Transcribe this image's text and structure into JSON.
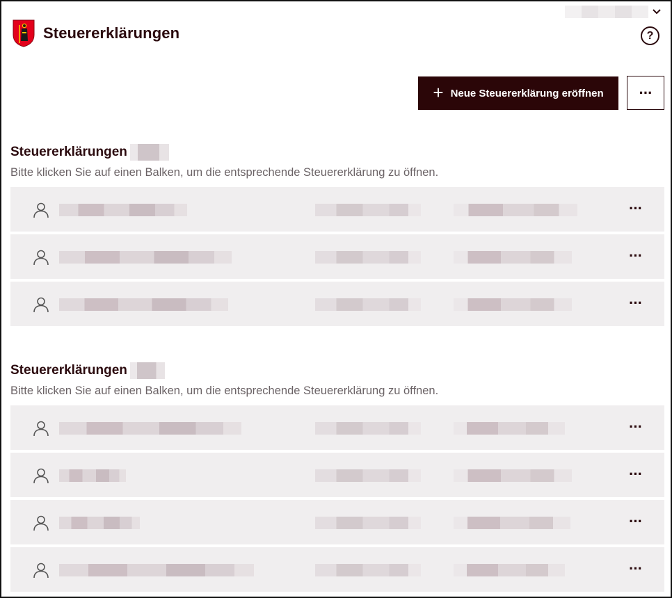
{
  "header": {
    "app_title": "Steuererklärungen",
    "help_label": "?"
  },
  "user_menu": {
    "icon": "chevron-down-icon"
  },
  "toolbar": {
    "new_label": "Neue Steuererklärung eröffnen",
    "more_label": "···"
  },
  "sections": [
    {
      "title": "Steuererklärungen",
      "subtitle": "Bitte klicken Sie auf einen Balken, um die entsprechende Steuererklärung zu öffnen.",
      "rows": [
        {
          "more": "···"
        },
        {
          "more": "···"
        },
        {
          "more": "···"
        }
      ]
    },
    {
      "title": "Steuererklärungen",
      "subtitle": "Bitte klicken Sie auf einen Balken, um die entsprechende Steuererklärung zu öffnen.",
      "rows": [
        {
          "more": "···"
        },
        {
          "more": "···"
        },
        {
          "more": "···"
        },
        {
          "more": "···"
        }
      ]
    }
  ],
  "colors": {
    "primary": "#2b0608",
    "text": "#2b0a0e",
    "row_bg": "#f0eeef",
    "subtitle": "#6b6366",
    "crest_red": "#e3001b"
  }
}
